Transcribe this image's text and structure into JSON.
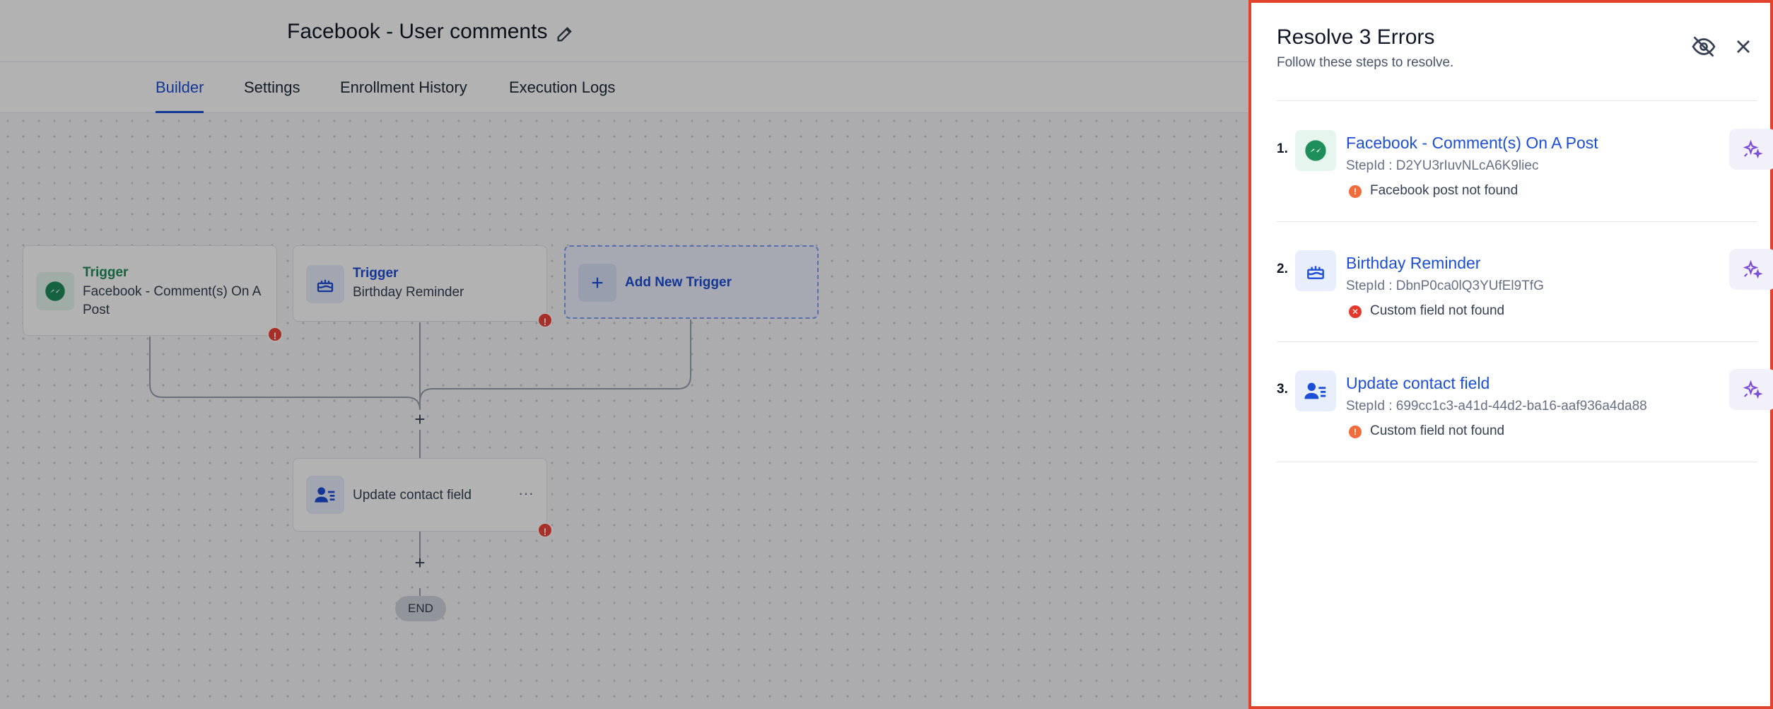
{
  "header": {
    "title": "Facebook - User comments",
    "tabs": [
      {
        "label": "Builder",
        "active": true
      },
      {
        "label": "Settings",
        "active": false
      },
      {
        "label": "Enrollment History",
        "active": false
      },
      {
        "label": "Execution Logs",
        "active": false
      }
    ]
  },
  "canvas": {
    "triggers": [
      {
        "kicker": "Trigger",
        "label": "Facebook - Comment(s) On A Post",
        "icon": "messenger-icon",
        "has_error": true
      },
      {
        "kicker": "Trigger",
        "label": "Birthday Reminder",
        "icon": "cake-icon",
        "has_error": true
      }
    ],
    "add_trigger_label": "Add New Trigger",
    "action": {
      "label": "Update contact field",
      "icon": "contact-list-icon",
      "has_error": true,
      "menu": "···"
    },
    "end_label": "END"
  },
  "panel": {
    "title": "Resolve 3 Errors",
    "subtitle": "Follow these steps to resolve.",
    "errors": [
      {
        "num": "1.",
        "title": "Facebook - Comment(s) On A Post",
        "step": "StepId : D2YU3rIuvNLcA6K9liec",
        "message": "Facebook post not found",
        "severity": "warning",
        "icon": "messenger-icon"
      },
      {
        "num": "2.",
        "title": "Birthday Reminder",
        "step": "StepId : DbnP0ca0lQ3YUfEl9TfG",
        "message": "Custom field not found",
        "severity": "error",
        "icon": "cake-icon"
      },
      {
        "num": "3.",
        "title": "Update contact field",
        "step": "StepId : 699cc1c3-a41d-44d2-ba16-aaf936a4da88",
        "message": "Custom field not found",
        "severity": "warning",
        "icon": "contact-list-icon"
      }
    ]
  },
  "colors": {
    "accent": "#1d4ed8",
    "panel_border": "#e0442c",
    "warning": "#f26b3a",
    "error": "#e5382d",
    "ai_fix": "#7c4ddb"
  }
}
